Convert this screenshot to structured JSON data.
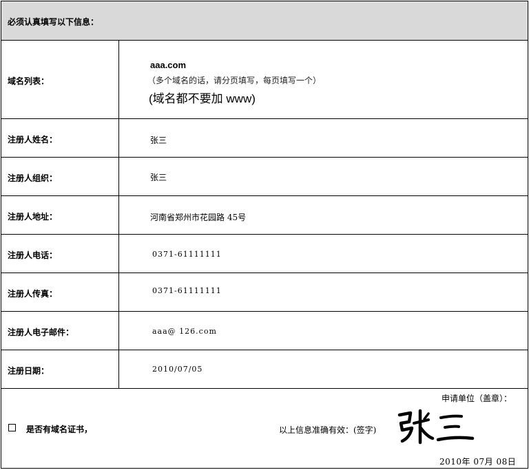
{
  "header": {
    "title": "必须认真填写以下信息："
  },
  "fields": [
    {
      "label": "域名列表：",
      "value": "aaa.com",
      "note": "（多个域名的话，请分页填写，每页填写一个）",
      "note2": "(域名都不要加 www)"
    },
    {
      "label": "注册人姓名：",
      "value": "张三"
    },
    {
      "label": "注册人组织：",
      "value": "张三"
    },
    {
      "label": "注册人地址：",
      "value": "河南省郑州市花园路 45号"
    },
    {
      "label": "注册人电话：",
      "value": "0371-61111111"
    },
    {
      "label": "注册人传真：",
      "value": "0371-61111111"
    },
    {
      "label": "注册人电子邮件：",
      "value": "aaa@ 126.com"
    },
    {
      "label": "注册日期：",
      "value": "2010/07/05"
    }
  ],
  "footer": {
    "unit_label": "申请单位（盖章）：",
    "certificate_label": "是否有域名证书，",
    "valid_label": "以上信息准确有效：(签字)",
    "signature": "张三",
    "date": "2010年   07月   08日"
  },
  "colors": {
    "header_bg": "#d9d9d9",
    "border": "#000000"
  }
}
